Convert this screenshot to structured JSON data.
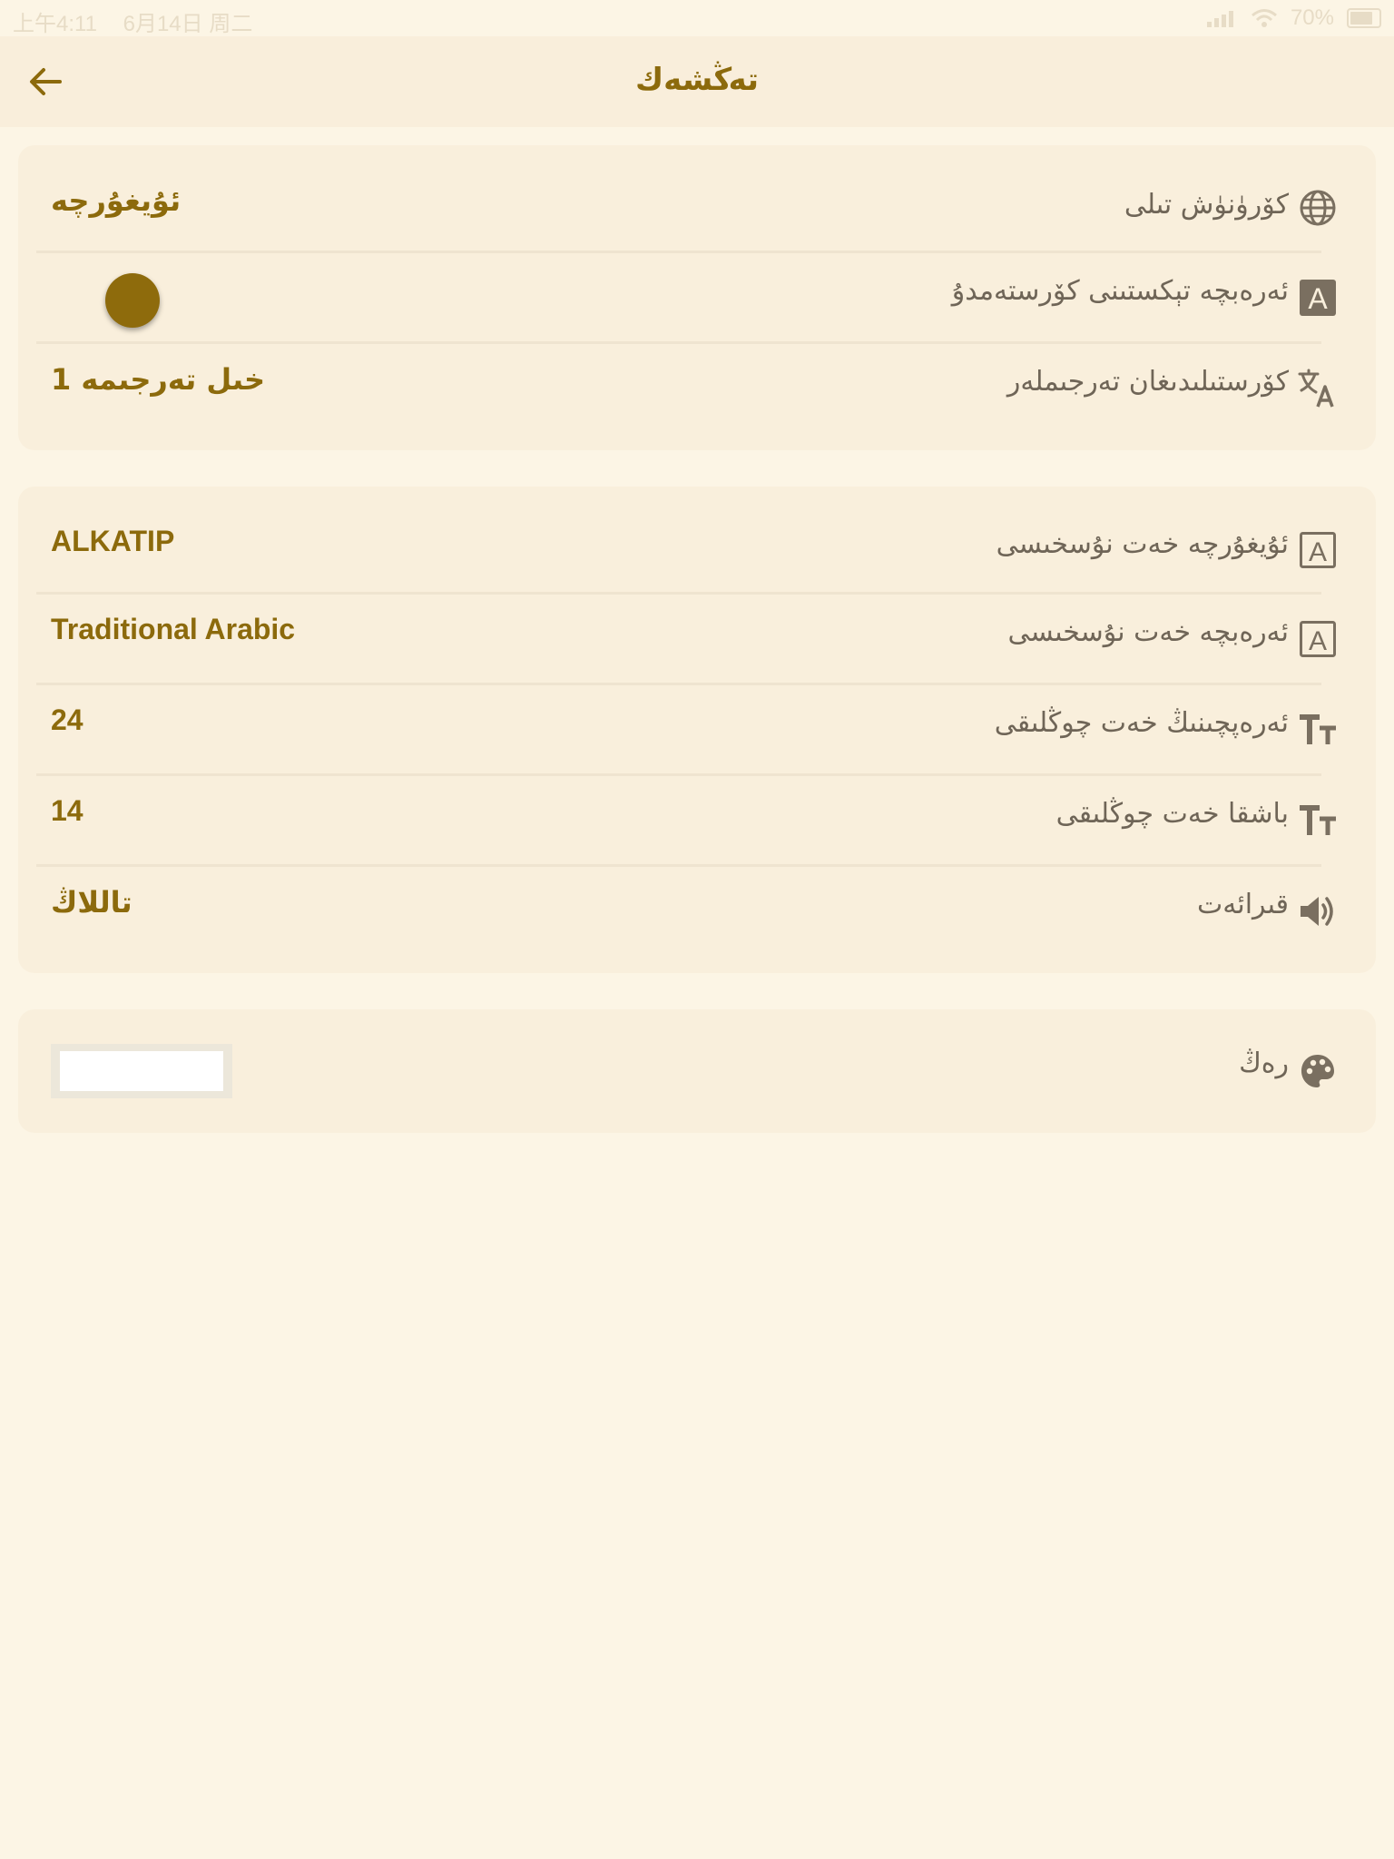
{
  "status_bar": {
    "time": "上午4:11",
    "date": "6月14日 周二",
    "battery": "70%"
  },
  "header": {
    "title": "تەڭشەك"
  },
  "section1": {
    "rows": [
      {
        "label": "كۆرۈنۈش تىلى",
        "value": "ئۇيغۇرچە",
        "icon": "globe-icon"
      },
      {
        "label": "ئەرەبچە تېكستىنى كۆرستەمدۇ",
        "icon": "letter-a-icon",
        "toggle_on": true
      },
      {
        "label": "كۆرستىلىدىغان تەرجىملەر",
        "value": "1 خىل تەرجىمە",
        "icon": "translate-icon"
      }
    ]
  },
  "section2": {
    "rows": [
      {
        "label": "ئۇيغۇرچە خەت نۇسخىسى",
        "value": "ALKATIP",
        "icon": "letter-a-outline-icon"
      },
      {
        "label": "ئەرەبچە خەت نۇسخىسى",
        "value": "Traditional Arabic",
        "icon": "letter-a-outline-icon"
      },
      {
        "label": "ئەرەپچىنىڭ خەت چوڭلىقى",
        "value": "24",
        "icon": "text-size-icon"
      },
      {
        "label": "باشقا خەت چوڭلىقى",
        "value": "14",
        "icon": "text-size-icon"
      },
      {
        "label": "قىرائەت",
        "value": "تاللاڭ",
        "icon": "speaker-icon"
      }
    ]
  },
  "section3": {
    "rows": [
      {
        "label": "رەڭ",
        "icon": "palette-icon",
        "swatch_color": "#ffffff"
      }
    ]
  },
  "colors": {
    "background": "#fcf5e5",
    "card": "#f9efdc",
    "accent": "#8c6a0c",
    "label": "#6f6557",
    "icon": "#7a6f60"
  }
}
